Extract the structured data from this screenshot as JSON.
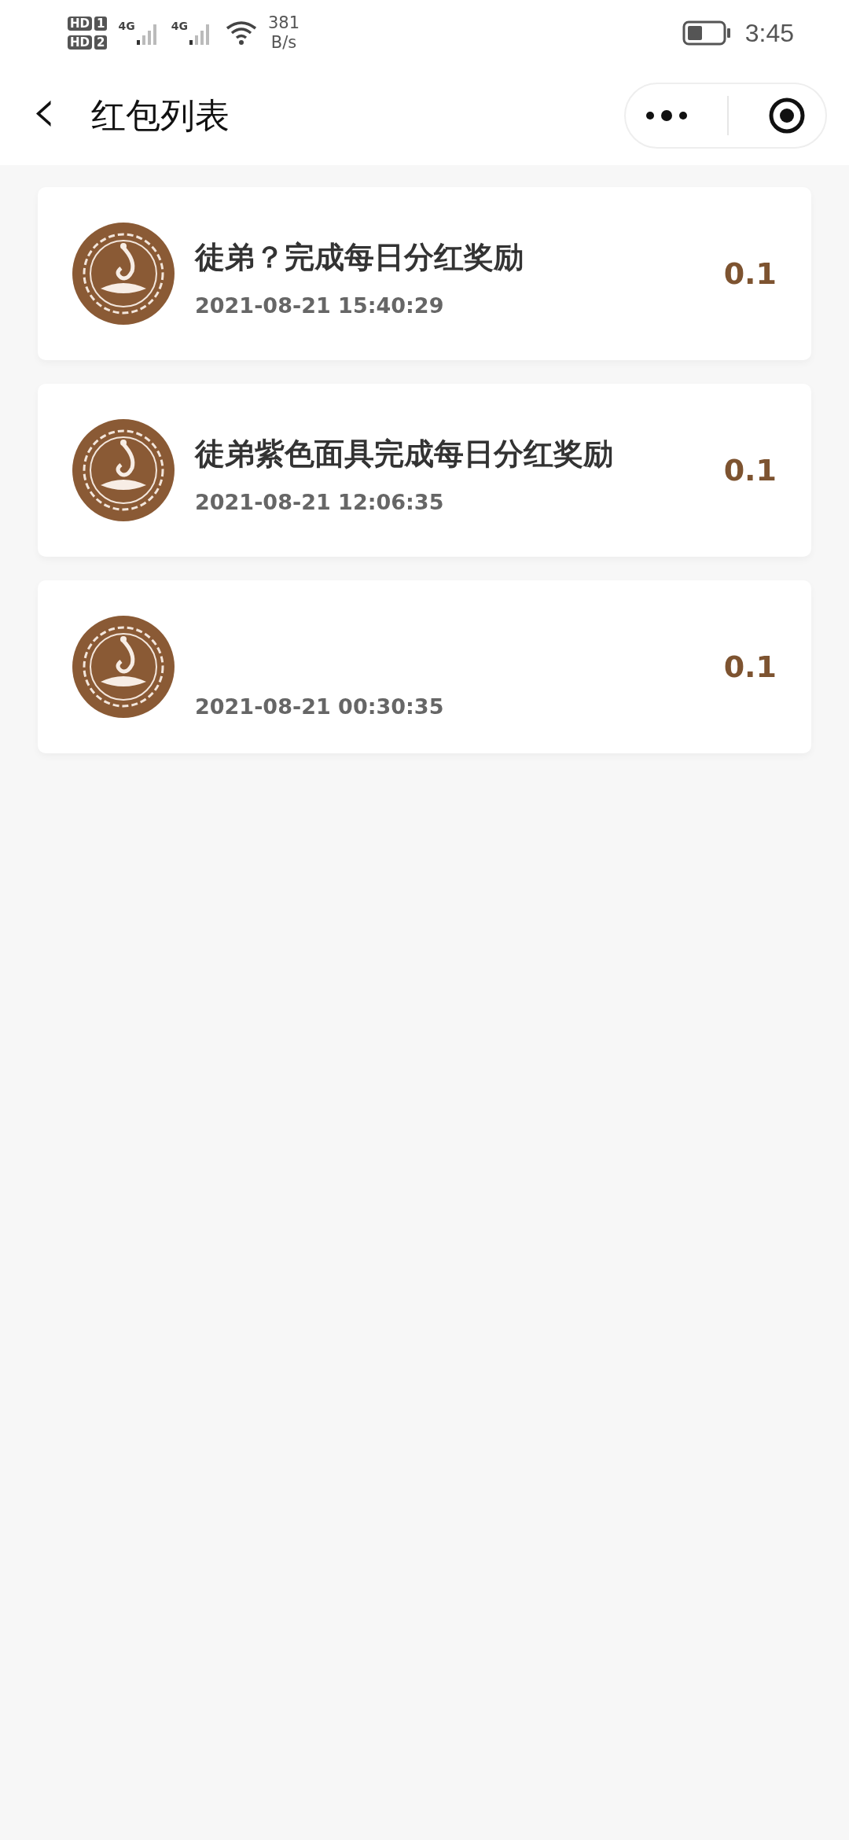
{
  "status_bar": {
    "sims": [
      {
        "badge": "HD",
        "slot": "1"
      },
      {
        "badge": "HD",
        "slot": "2"
      }
    ],
    "networks": [
      "4G",
      "4G"
    ],
    "speed_value": "381",
    "speed_unit": "B/s",
    "time": "3:45"
  },
  "nav_bar": {
    "back_icon": "‹",
    "title": "红包列表"
  },
  "items": [
    {
      "title": "徒弟？完成每日分红奖励",
      "time": "2021-08-21 15:40:29",
      "amount": "0.1"
    },
    {
      "title": "徒弟紫色面具完成每日分红奖励",
      "time": "2021-08-21 12:06:35",
      "amount": "0.1"
    },
    {
      "time": "2021-08-21 00:30:35",
      "amount": "0.1"
    }
  ]
}
